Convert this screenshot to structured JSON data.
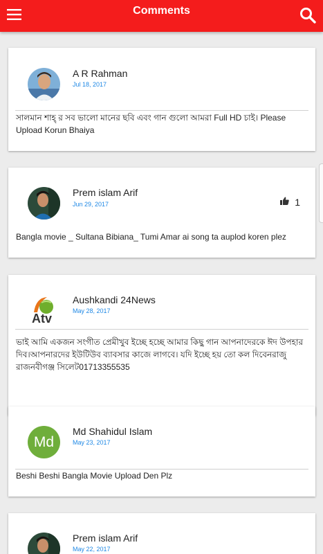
{
  "appbar": {
    "title": "Comments",
    "menu_icon": "hamburger-menu-icon",
    "search_icon": "search-icon",
    "color": "#f41c1c"
  },
  "accent_date_color": "#1e88e5",
  "comments": [
    {
      "author": "A R Rahman",
      "date": "Jul 18, 2017",
      "text": "সালমান শাহ্ র সব ভালো মানের ছবি এবং গান গুলো আমরা Full HD চাই। Please Upload Korun Bhaiya"
    },
    {
      "author": "Prem islam Arif",
      "date": "Jun 29, 2017",
      "likes": "1",
      "text": "Bangla movie _ Sultana Bibiana_ Tumi Amar ai song ta auplod koren plez"
    },
    {
      "author": "Aushkandi 24News",
      "date": "May 28, 2017",
      "avatar_text": "Atv",
      "text": "ভাই আমি একজন সংগীত প্রেমীখুব ইচ্ছে হচ্ছে আমার কিছু গান আপনাদেরকে ঈদ উপহার দিব।আপনারদের ইউটিউব ব্যাবসার কাজে লাগবে। যদি ইচ্ছে হয় তো কল দিবেনরাজু রাজনবীগঞ্জ সিলেট01713355535"
    },
    {
      "author": "Md Shahidul Islam",
      "date": "May 23, 2017",
      "avatar_text": "Md",
      "text": "Beshi Beshi Bangla Movie Upload Den Plz"
    },
    {
      "author": "Prem islam Arif",
      "date": "May 22, 2017",
      "text": ""
    }
  ]
}
